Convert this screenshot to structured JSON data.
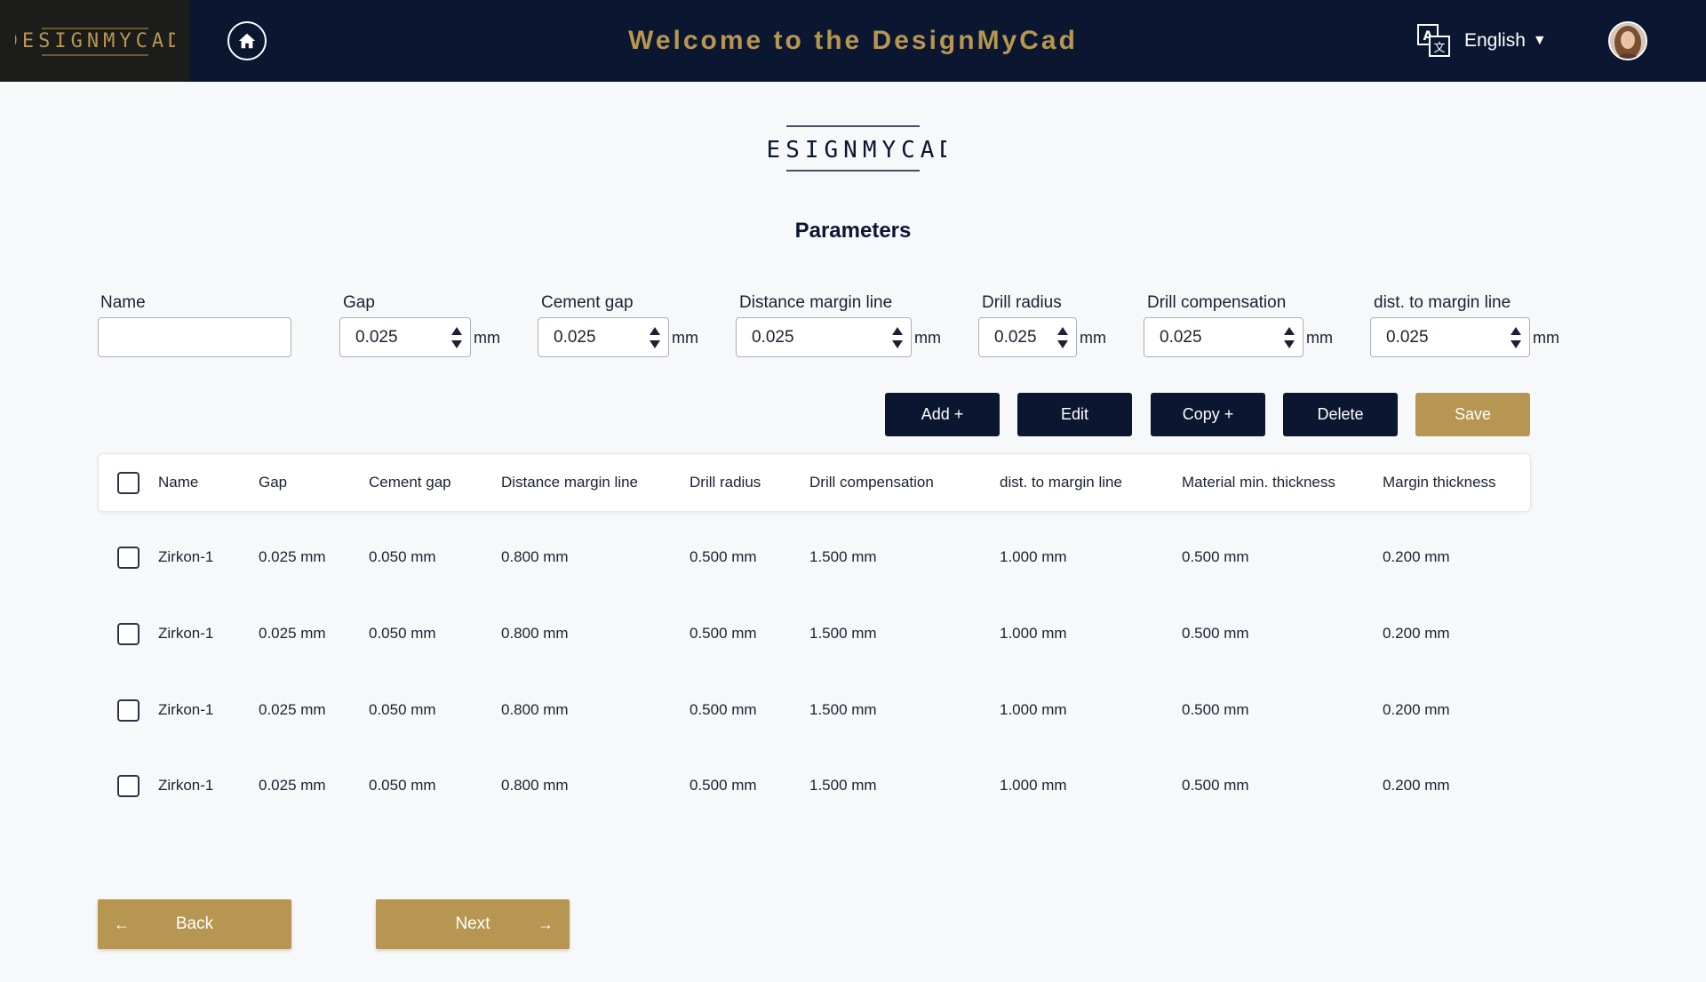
{
  "header": {
    "logo_text": "DESIGNMYCAD",
    "welcome": "Welcome to the DesignMyCad",
    "language": "English",
    "icons": {
      "home": "home-icon",
      "translate": "translate-icon",
      "caret": "caret-down-icon",
      "avatar": "user-avatar"
    }
  },
  "brand": {
    "logo_text": "DESIGNMYCAD",
    "colors": {
      "navy": "#0b1631",
      "gold": "#b69650"
    }
  },
  "page": {
    "title": "Parameters"
  },
  "form": {
    "name": {
      "label": "Name",
      "value": ""
    },
    "fields": [
      {
        "label": "Gap",
        "value": "0.025",
        "unit": "mm"
      },
      {
        "label": "Cement gap",
        "value": "0.025",
        "unit": "mm"
      },
      {
        "label": "Distance margin line",
        "value": "0.025",
        "unit": "mm"
      },
      {
        "label": "Drill radius",
        "value": "0.025",
        "unit": "mm"
      },
      {
        "label": "Drill compensation",
        "value": "0.025",
        "unit": "mm"
      },
      {
        "label": "dist. to margin line",
        "value": "0.025",
        "unit": "mm"
      }
    ]
  },
  "actions": {
    "add": "Add +",
    "edit": "Edit",
    "copy": "Copy +",
    "delete": "Delete",
    "save": "Save"
  },
  "table": {
    "columns": [
      "Name",
      "Gap",
      "Cement gap",
      "Distance margin line",
      "Drill radius",
      "Drill compensation",
      "dist. to margin line",
      "Material min. thickness",
      "Margin thickness"
    ],
    "rows": [
      [
        "Zirkon-1",
        "0.025 mm",
        "0.050 mm",
        "0.800 mm",
        "0.500 mm",
        "1.500 mm",
        "1.000 mm",
        "0.500 mm",
        "0.200 mm"
      ],
      [
        "Zirkon-1",
        "0.025 mm",
        "0.050 mm",
        "0.800 mm",
        "0.500 mm",
        "1.500 mm",
        "1.000 mm",
        "0.500 mm",
        "0.200 mm"
      ],
      [
        "Zirkon-1",
        "0.025 mm",
        "0.050 mm",
        "0.800 mm",
        "0.500 mm",
        "1.500 mm",
        "1.000 mm",
        "0.500 mm",
        "0.200 mm"
      ],
      [
        "Zirkon-1",
        "0.025 mm",
        "0.050 mm",
        "0.800 mm",
        "0.500 mm",
        "1.500 mm",
        "1.000 mm",
        "0.500 mm",
        "0.200 mm"
      ]
    ]
  },
  "nav": {
    "back": "Back",
    "next": "Next",
    "back_icon": "arrow-left-icon",
    "next_icon": "arrow-right-icon"
  }
}
